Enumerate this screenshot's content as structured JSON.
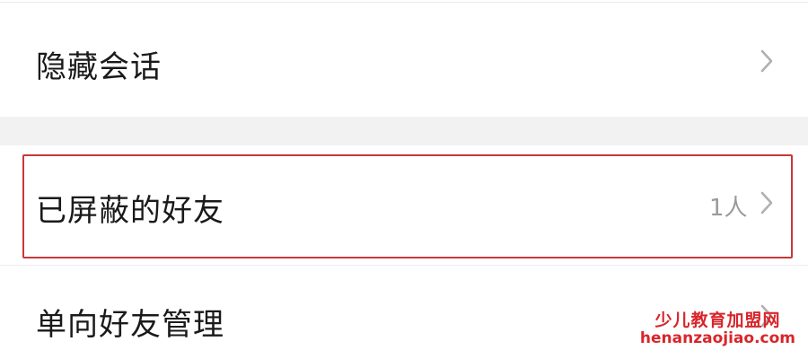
{
  "settings_list": {
    "items": [
      {
        "label": "隐藏会话",
        "value": ""
      },
      {
        "label": "已屏蔽的好友",
        "value": "1人"
      },
      {
        "label": "单向好友管理",
        "value": ""
      }
    ]
  },
  "colors": {
    "highlight_border": "#c8373c",
    "section_gap": "#f2f2f2",
    "label_text": "#1a1a1a",
    "secondary_text": "#9a9a9a",
    "chevron": "#b0b0b0",
    "watermark": "#d8262b"
  },
  "icons": {
    "row_arrow": "chevron-right-icon"
  },
  "watermark": {
    "title": "少儿教育加盟网",
    "domain": "henanzaojiao.com"
  }
}
